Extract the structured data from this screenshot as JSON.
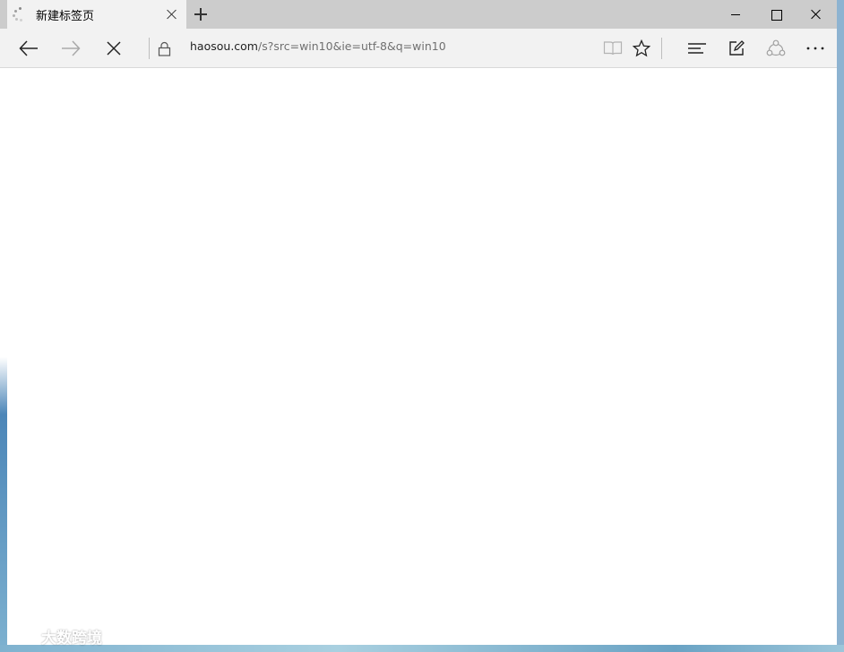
{
  "tab": {
    "title": "新建标签页"
  },
  "address": {
    "domain": "haosou.com",
    "path": "/s?src=win10&ie=utf-8&q=win10"
  },
  "watermark": {
    "text": "大数跨境"
  },
  "icons": {
    "tab_status": "loading-spinner-icon",
    "back": "arrow-left-icon",
    "forward": "arrow-right-icon",
    "stop": "close-icon",
    "lock": "lock-icon",
    "reading_view": "book-icon",
    "favorite": "star-icon",
    "hub": "hub-lines-icon",
    "web_note": "pen-square-icon",
    "share": "share-icon",
    "more": "more-dots-icon"
  },
  "colors": {
    "titlebar": "#cccccc",
    "toolbar": "#f2f2f2",
    "url_path": "#707070"
  }
}
